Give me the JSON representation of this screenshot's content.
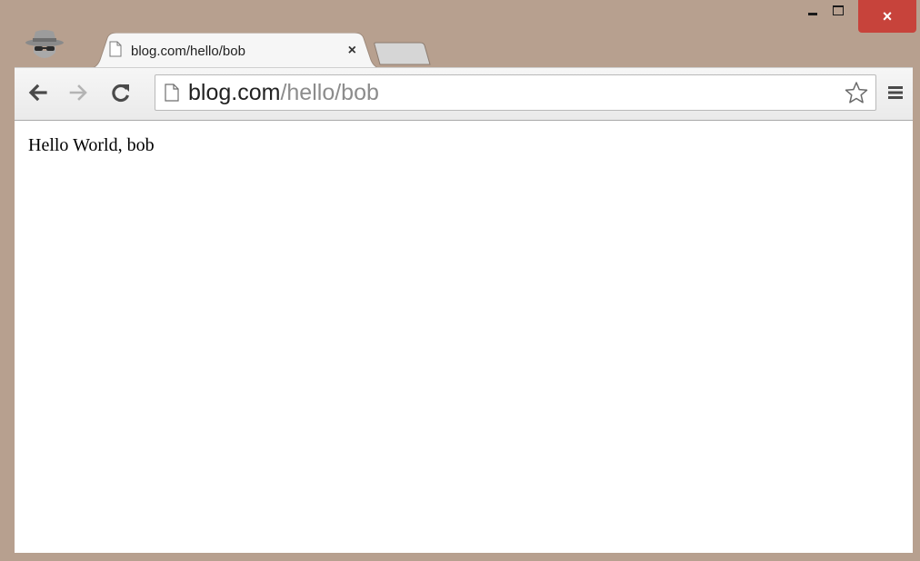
{
  "tab": {
    "title": "blog.com/hello/bob",
    "close_glyph": "×",
    "favicon": "page-icon"
  },
  "window_controls": {
    "minimize": "minimize-icon",
    "maximize": "maximize-icon",
    "close": "close-icon",
    "close_glyph": "×"
  },
  "toolbar": {
    "back": "back-arrow-icon",
    "forward": "forward-arrow-icon",
    "reload": "reload-icon",
    "bookmark": "star-icon",
    "menu": "hamburger-menu-icon"
  },
  "omnibox": {
    "host": "blog.com",
    "path": "/hello/bob"
  },
  "page": {
    "text": "Hello World, bob"
  },
  "colors": {
    "window_frame": "#b7a08f",
    "close_button": "#c7433b",
    "url_host": "#222222",
    "url_path": "#8c8c8c"
  }
}
